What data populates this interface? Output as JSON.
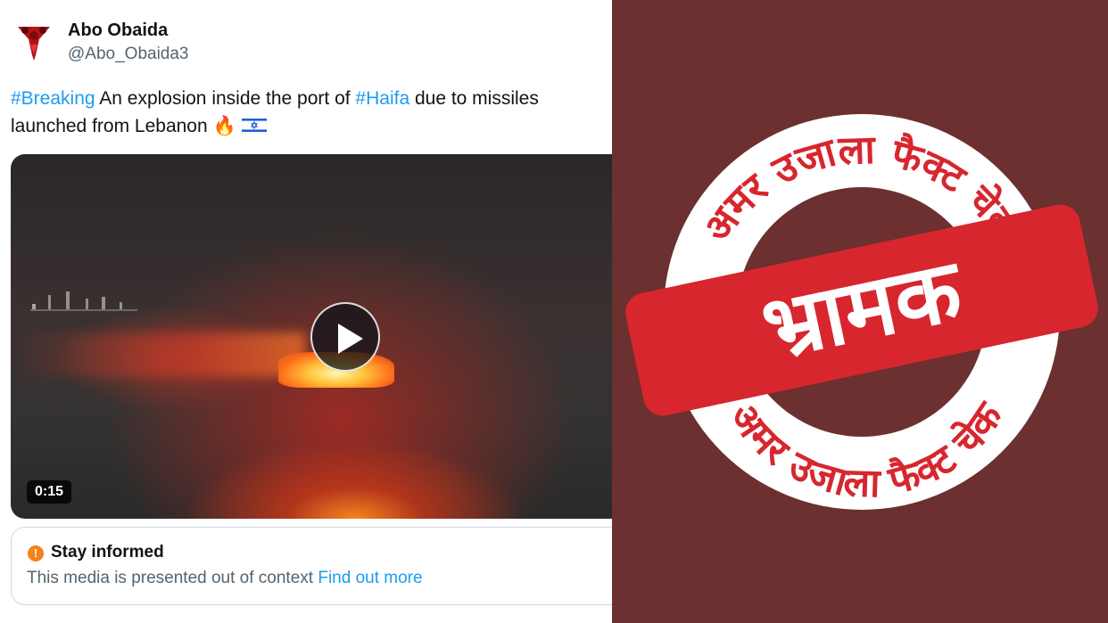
{
  "tweet": {
    "author_name": "Abo Obaida",
    "author_handle": "@Abo_Obaida3",
    "text_parts": {
      "hashtag1": "#Breaking",
      "middle1": " An explosion inside the port of ",
      "hashtag2": "#Haifa",
      "middle2": " due to missiles launched from Lebanon ",
      "emoji": "🔥"
    },
    "flag_icon": "israel-flag-icon",
    "video": {
      "duration": "0:15",
      "play_icon": "play-icon"
    },
    "notice": {
      "icon": "exclamation-icon",
      "icon_glyph": "!",
      "title": "Stay informed",
      "body": "This media is presented out of context",
      "link": "Find out more"
    }
  },
  "stamp": {
    "seal_text_top": "अमर उजाला फैक्ट चेक",
    "seal_text_bottom": "अमर उजाला फैक्ट चेक",
    "verdict": "भ्रामक"
  },
  "colors": {
    "panel_bg": "#6b302f",
    "seal_ring": "#ffffff",
    "seal_red": "#d7262e",
    "hashtag_blue": "#1d9bf0",
    "notice_orange": "#f7811b"
  }
}
